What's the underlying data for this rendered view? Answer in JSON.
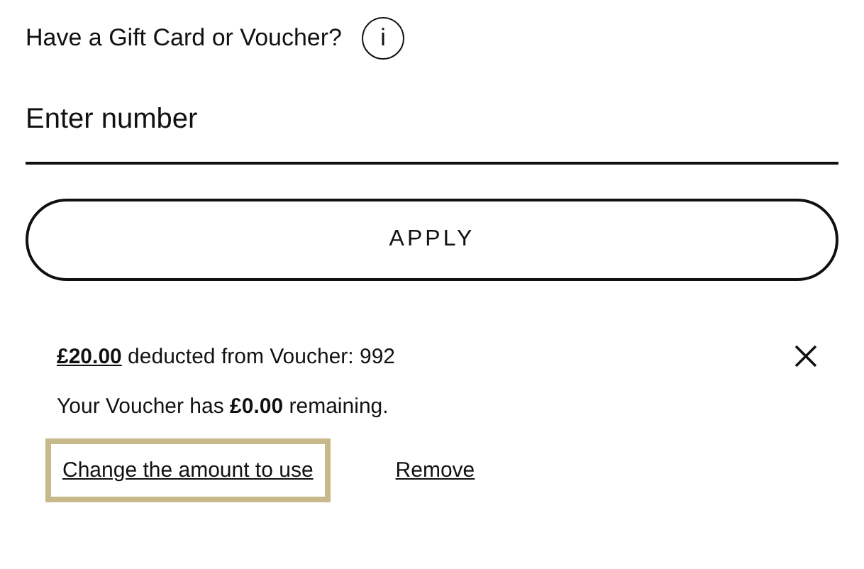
{
  "heading": "Have a Gift Card or Voucher?",
  "info_button": "i",
  "voucher_field": {
    "placeholder": "Enter number"
  },
  "apply_button": "APPLY",
  "applied_voucher": {
    "amount": "£20.00",
    "deduction_text": "deducted from Voucher: 992",
    "remaining": "Your Voucher has **£0.00** remaining.",
    "links": [
      {
        "label": "Change the amount to use",
        "focused": true
      },
      {
        "label": "Remove",
        "focused": false
      }
    ]
  }
}
